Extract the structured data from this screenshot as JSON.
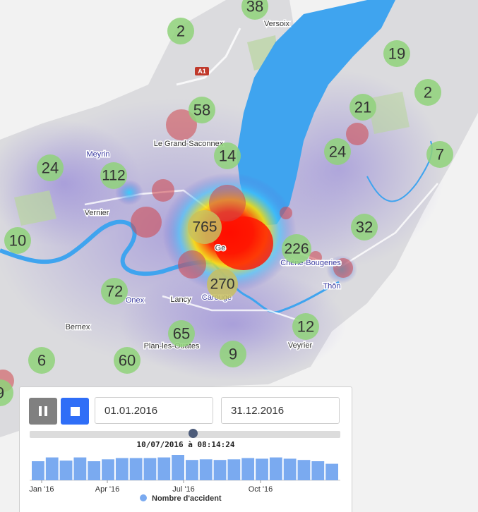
{
  "map": {
    "road_shield": "A1",
    "towns": [
      {
        "name": "Versoix",
        "style": "normal"
      },
      {
        "name": "Le Grand-Saconnex",
        "style": "normal"
      },
      {
        "name": "Meyrin",
        "style": "blue"
      },
      {
        "name": "Vernier",
        "style": "normal"
      },
      {
        "name": "Onex",
        "style": "blue"
      },
      {
        "name": "Lancy",
        "style": "normal"
      },
      {
        "name": "Carouge",
        "style": "blue"
      },
      {
        "name": "Bernex",
        "style": "normal"
      },
      {
        "name": "Plan-les-Ouates",
        "style": "normal"
      },
      {
        "name": "Veyrier",
        "style": "normal"
      },
      {
        "name": "Chêne-Bougeries",
        "style": "blue"
      },
      {
        "name": "Thôn",
        "style": "blue"
      },
      {
        "name": "Ge",
        "style": "normal"
      }
    ],
    "clusters": [
      "38",
      "2",
      "19",
      "2",
      "21",
      "58",
      "24",
      "7",
      "24",
      "112",
      "14",
      "10",
      "765",
      "226",
      "32",
      "72",
      "270",
      "65",
      "12",
      "6",
      "60",
      "9",
      "9"
    ],
    "colors": {
      "lake": "#3fa4ef",
      "cluster": "#8fd27a",
      "accident_dot": "#d0454a",
      "density": "#8a7ad8"
    }
  },
  "controls": {
    "pause_icon": "pause-icon",
    "stop_icon": "stop-icon",
    "start_date": "01.01.2016",
    "end_date": "31.12.2016",
    "current_time": "10/07/2016 à 08:14:24",
    "slider_progress": 0.525,
    "accent": "#2f6ef7"
  },
  "chart_data": {
    "type": "bar",
    "title": "",
    "series": [
      {
        "name": "Nombre d'accident",
        "values": [
          30,
          36,
          31,
          36,
          30,
          33,
          35,
          35,
          35,
          36,
          40,
          32,
          33,
          32,
          33,
          35,
          34,
          36,
          34,
          32,
          30,
          26
        ]
      }
    ],
    "x_ticks": [
      "Jan '16",
      "Apr '16",
      "Jul '16",
      "Oct '16"
    ],
    "legend": "bottom",
    "color": "#7aaaf0"
  }
}
